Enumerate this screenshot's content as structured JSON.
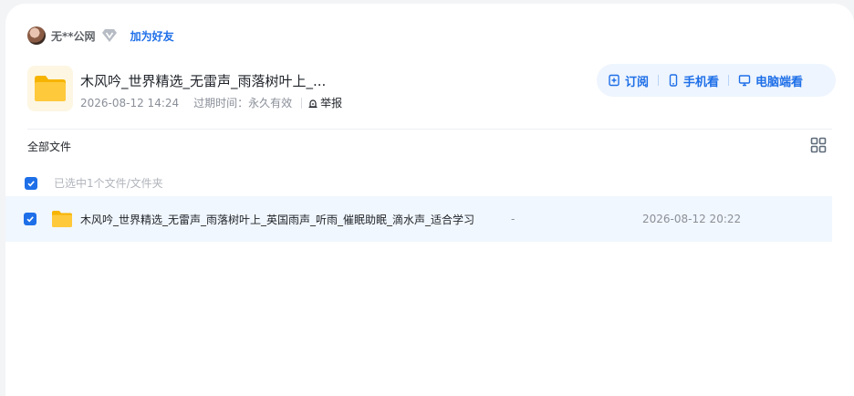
{
  "user": {
    "name": "无**公网",
    "add_friend": "加为好友"
  },
  "share": {
    "title": "木风吟_世界精选_无雷声_雨落树叶上_...",
    "date": "2026-08-12 14:24",
    "expiry_label": "过期时间：永久有效",
    "report": "举报"
  },
  "actions": {
    "subscribe": "订阅",
    "mobile": "手机看",
    "desktop": "电脑端看"
  },
  "list": {
    "all_files": "全部文件",
    "selected_text": "已选中1个文件/文件夹",
    "files": [
      {
        "name": "木风吟_世界精选_无雷声_雨落树叶上_英国雨声_听雨_催眠助眠_滴水声_适合学习",
        "size": "-",
        "date": "2026-08-12 20:22"
      }
    ]
  },
  "colors": {
    "accent": "#1e6fe8",
    "action_bg": "#eef5fe",
    "row_selected_bg": "#f1f7fe",
    "folder": "#ffc93c"
  }
}
